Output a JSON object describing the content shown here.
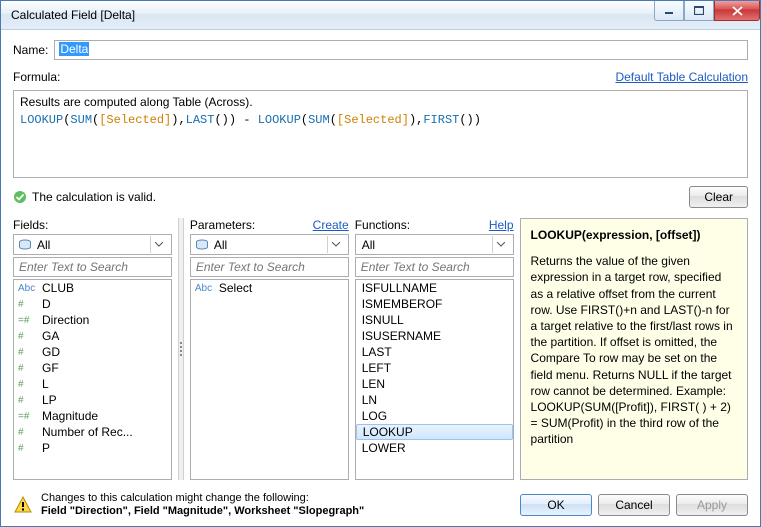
{
  "window": {
    "title": "Calculated Field [Delta]"
  },
  "name": {
    "label": "Name:",
    "value": "Delta"
  },
  "formula": {
    "label": "Formula:",
    "default_link": "Default Table Calculation",
    "comment": "Results are computed along Table (Across).",
    "tokens": [
      {
        "t": "fn",
        "v": "LOOKUP"
      },
      {
        "t": "p",
        "v": "("
      },
      {
        "t": "fn",
        "v": "SUM"
      },
      {
        "t": "p",
        "v": "("
      },
      {
        "t": "field",
        "v": "[Selected]"
      },
      {
        "t": "p",
        "v": ")"
      },
      {
        "t": "p",
        "v": ","
      },
      {
        "t": "fn",
        "v": "LAST"
      },
      {
        "t": "p",
        "v": "()"
      },
      {
        "t": "p",
        "v": ")"
      },
      {
        "t": "p",
        "v": " - "
      },
      {
        "t": "fn",
        "v": "LOOKUP"
      },
      {
        "t": "p",
        "v": "("
      },
      {
        "t": "fn",
        "v": "SUM"
      },
      {
        "t": "p",
        "v": "("
      },
      {
        "t": "field",
        "v": "[Selected]"
      },
      {
        "t": "p",
        "v": ")"
      },
      {
        "t": "p",
        "v": ","
      },
      {
        "t": "fn",
        "v": "FIRST"
      },
      {
        "t": "p",
        "v": "()"
      },
      {
        "t": "p",
        "v": ")"
      }
    ]
  },
  "valid_text": "The calculation is valid.",
  "clear_label": "Clear",
  "fields": {
    "label": "Fields:",
    "filter": "All",
    "search_placeholder": "Enter Text to Search",
    "items": [
      {
        "type": "abc",
        "name": "CLUB"
      },
      {
        "type": "num",
        "name": "D"
      },
      {
        "type": "calc",
        "name": "Direction"
      },
      {
        "type": "num",
        "name": "GA"
      },
      {
        "type": "num",
        "name": "GD"
      },
      {
        "type": "num",
        "name": "GF"
      },
      {
        "type": "num",
        "name": "L"
      },
      {
        "type": "num",
        "name": "LP"
      },
      {
        "type": "calc",
        "name": "Magnitude"
      },
      {
        "type": "num",
        "name": "Number of Rec..."
      },
      {
        "type": "num",
        "name": "P"
      }
    ]
  },
  "parameters": {
    "label": "Parameters:",
    "create_link": "Create",
    "filter": "All",
    "search_placeholder": "Enter Text to Search",
    "items": [
      {
        "type": "abc",
        "name": "Select"
      }
    ]
  },
  "functions": {
    "label": "Functions:",
    "help_link": "Help",
    "filter": "All",
    "search_placeholder": "Enter Text to Search",
    "items": [
      "ISFULLNAME",
      "ISMEMBEROF",
      "ISNULL",
      "ISUSERNAME",
      "LAST",
      "LEFT",
      "LEN",
      "LN",
      "LOG",
      "LOOKUP",
      "LOWER"
    ],
    "selected": "LOOKUP"
  },
  "help": {
    "title": "LOOKUP(expression, [offset])",
    "body": "Returns the value of the given expression in a target row, specified as a relative offset from the current row. Use FIRST()+n and LAST()-n for a target relative to the first/last rows in the partition. If offset is omitted, the Compare To row may be set on the field menu. Returns NULL if the target row cannot be determined. Example: LOOKUP(SUM([Profit]), FIRST( ) + 2) = SUM(Profit) in the third row of the partition"
  },
  "warning": {
    "line1": "Changes to this calculation might change the following:",
    "line2": "Field \"Direction\", Field \"Magnitude\", Worksheet \"Slopegraph\""
  },
  "buttons": {
    "ok": "OK",
    "cancel": "Cancel",
    "apply": "Apply"
  }
}
